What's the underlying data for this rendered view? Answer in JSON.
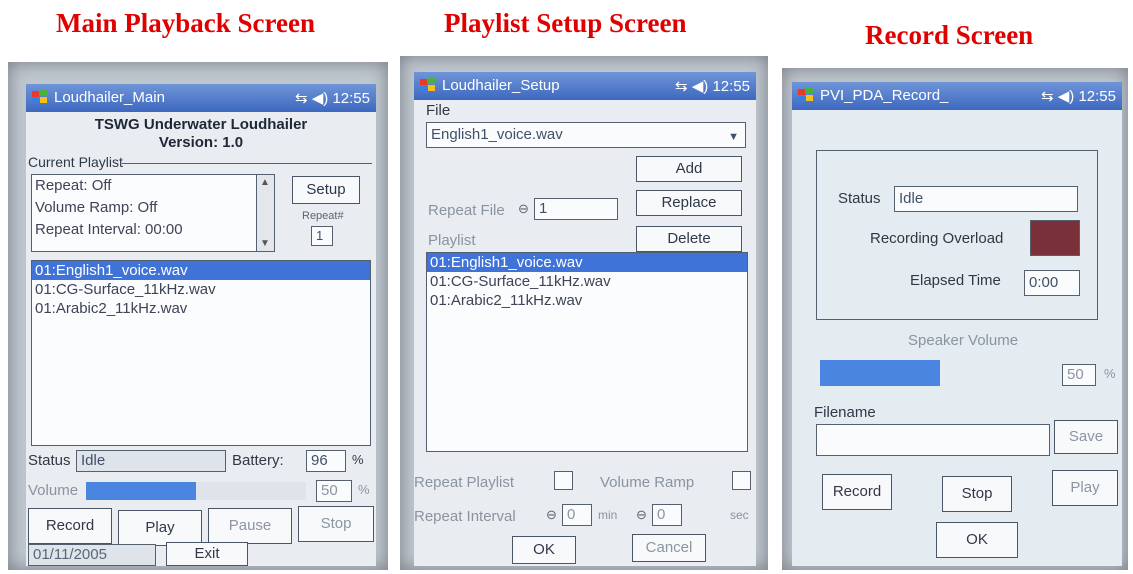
{
  "captions": {
    "main": "Main Playback Screen",
    "setup": "Playlist Setup Screen",
    "record": "Record Screen"
  },
  "status_area": {
    "clock": "12:55",
    "connectivity_icon": "connectivity-icon",
    "volume_icon": "speaker-icon"
  },
  "main_screen": {
    "window_title": "Loudhailer_Main",
    "heading_line1": "TSWG Underwater Loudhailer",
    "heading_line2": "Version: 1.0",
    "current_playlist_label": "Current Playlist",
    "settings_lines": [
      "Repeat: Off",
      "Volume Ramp: Off",
      "Repeat Interval: 00:00"
    ],
    "setup_button": "Setup",
    "repeat_hash_label": "Repeat#",
    "repeat_hash_value": "1",
    "playlist": [
      "01:English1_voice.wav",
      "01:CG-Surface_11kHz.wav",
      "01:Arabic2_11kHz.wav"
    ],
    "selected_index": 0,
    "status_label": "Status",
    "status_value": "Idle",
    "battery_label": "Battery:",
    "battery_value": "96",
    "battery_unit": "%",
    "volume_label": "Volume",
    "volume_percent": 50,
    "volume_value": "50",
    "volume_unit": "%",
    "buttons": {
      "record": "Record",
      "play": "Play",
      "pause": "Pause",
      "stop": "Stop",
      "exit": "Exit"
    },
    "date": "01/11/2005"
  },
  "setup_screen": {
    "window_title": "Loudhailer_Setup",
    "file_label": "File",
    "file_selected": "English1_voice.wav",
    "add_button": "Add",
    "repeat_file_label": "Repeat File",
    "repeat_file_value": "1",
    "replace_button": "Replace",
    "playlist_label": "Playlist",
    "delete_button": "Delete",
    "playlist": [
      "01:English1_voice.wav",
      "01:CG-Surface_11kHz.wav",
      "01:Arabic2_11kHz.wav"
    ],
    "selected_index": 0,
    "repeat_playlist_label": "Repeat Playlist",
    "volume_ramp_label": "Volume Ramp",
    "repeat_interval_label": "Repeat Interval",
    "interval_min_value": "0",
    "interval_min_unit": "min",
    "interval_sec_value": "0",
    "interval_sec_unit": "sec",
    "ok_button": "OK",
    "cancel_button": "Cancel"
  },
  "record_screen": {
    "window_title": "PVI_PDA_Record_",
    "status_label": "Status",
    "status_value": "Idle",
    "overload_label": "Recording Overload",
    "overload_color": "#7a3038",
    "elapsed_label": "Elapsed Time",
    "elapsed_value": "0:00",
    "speaker_volume_label": "Speaker Volume",
    "speaker_volume_percent": 50,
    "speaker_volume_value": "50",
    "speaker_volume_unit": "%",
    "filename_label": "Filename",
    "filename_value": "",
    "save_button": "Save",
    "record_button": "Record",
    "stop_button": "Stop",
    "play_button": "Play",
    "ok_button": "OK"
  },
  "colors": {
    "caption": "#e00000",
    "titlebar": "#4a72c8",
    "selection": "#3f73d8",
    "level_bar": "#4a86e0"
  }
}
